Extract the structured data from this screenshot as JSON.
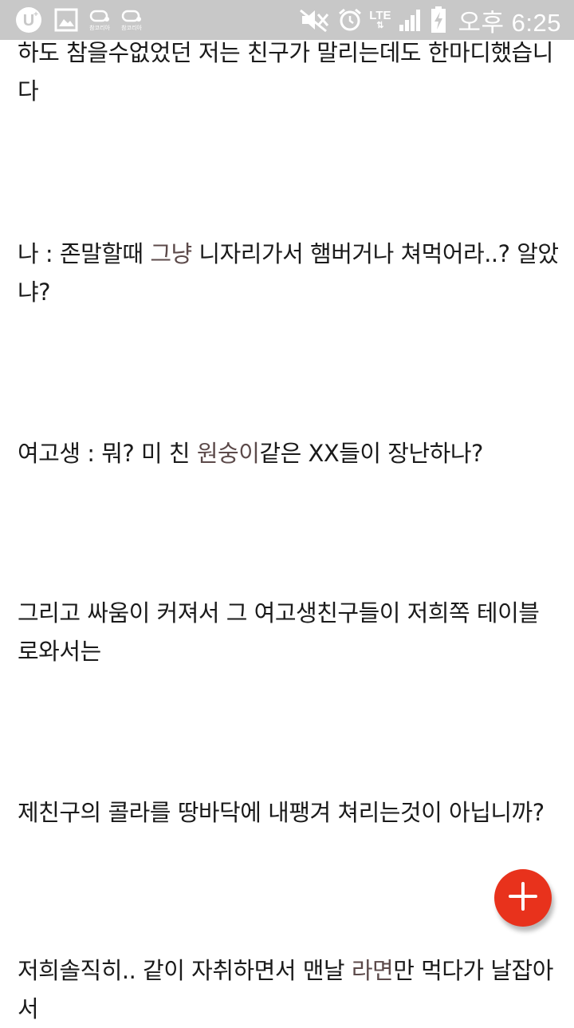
{
  "status_bar": {
    "app_label_1": "참코리아",
    "app_label_2": "참코리아",
    "network": "LTE",
    "network_arrows": "⇅",
    "time": "오후 6:25"
  },
  "paragraphs": [
    {
      "text": "하도 참을수없었던 저는 친구가 말리는데도 한마디했습니다"
    },
    {
      "pre": "나 : 존말할때 ",
      "hl": "그냥",
      "post": " 니자리가서 햄버거나 쳐먹어라..? 알았냐?"
    },
    {
      "pre": "여고생 : 뭐? 미 친 ",
      "hl": "원숭이",
      "post": "같은 XX들이 장난하나?"
    },
    {
      "text": "그리고 싸움이 커져서 그 여고생친구들이 저희쪽 테이블로와서는"
    },
    {
      "text": "제친구의 콜라를 땅바닥에 내팽겨 쳐리는것이 아닙니까?"
    },
    {
      "pre": "저희솔직히.. 같이 자취하면서 맨날 ",
      "hl": "라면",
      "post": "만 먹다가 날잡아서"
    }
  ],
  "colors": {
    "status_bar_bg": "#c8c8c8",
    "fab": "#e8321c",
    "highlight_text": "#5c4a4a"
  },
  "icons": [
    "u-plus-icon",
    "gallery-icon",
    "app-icon",
    "app-icon",
    "mute-icon",
    "alarm-icon",
    "signal-icon",
    "battery-charging-icon",
    "plus-icon"
  ]
}
